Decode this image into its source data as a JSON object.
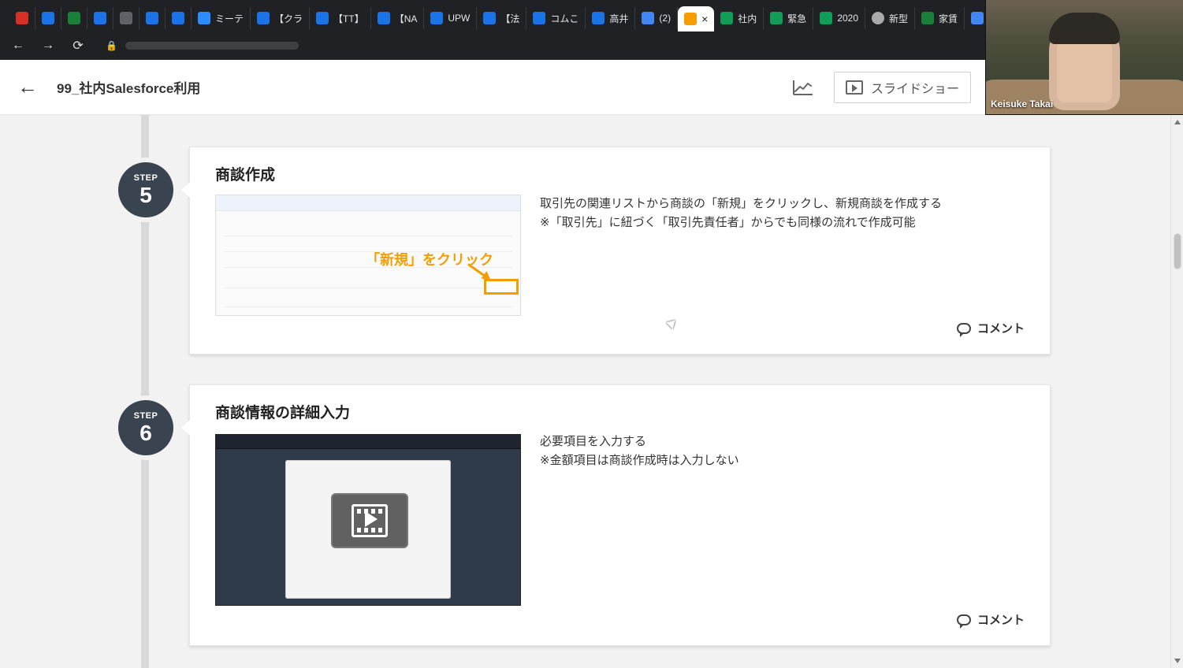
{
  "browser": {
    "tabs": [
      {
        "label": "",
        "icon": "gmail-icon",
        "active": false
      },
      {
        "label": "",
        "icon": "calendar-icon",
        "active": false
      },
      {
        "label": "",
        "icon": "drive-icon",
        "active": false
      },
      {
        "label": "",
        "icon": "blue-dot-icon",
        "active": false
      },
      {
        "label": "",
        "icon": "cloud-icon",
        "active": false
      },
      {
        "label": "",
        "icon": "chat-icon",
        "active": false
      },
      {
        "label": "",
        "icon": "salesforce-icon",
        "active": false
      },
      {
        "label": "ミーテ",
        "icon": "zoom-icon",
        "active": false
      },
      {
        "label": "【クラ",
        "icon": "salesforce-icon",
        "active": false
      },
      {
        "label": "【TT】",
        "icon": "salesforce-icon",
        "active": false
      },
      {
        "label": "【NA",
        "icon": "salesforce-icon",
        "active": false
      },
      {
        "label": "UPW",
        "icon": "salesforce-icon",
        "active": false
      },
      {
        "label": "【法",
        "icon": "salesforce-icon",
        "active": false
      },
      {
        "label": "コムこ",
        "icon": "salesforce-icon",
        "active": false
      },
      {
        "label": "高井",
        "icon": "salesforce-icon",
        "active": false
      },
      {
        "label": "(2)",
        "icon": "doc-icon",
        "active": false
      },
      {
        "label": "",
        "icon": "app-icon",
        "active": true,
        "close": "×"
      },
      {
        "label": "社内",
        "icon": "sheet-icon",
        "active": false
      },
      {
        "label": "緊急",
        "icon": "sheet-icon",
        "active": false
      },
      {
        "label": "2020",
        "icon": "sheet-icon",
        "active": false
      },
      {
        "label": "新型",
        "icon": "globe-icon",
        "active": false
      },
      {
        "label": "家賃",
        "icon": "drive-icon",
        "active": false
      },
      {
        "label": "",
        "icon": "document-icon",
        "active": false
      }
    ],
    "nav": {
      "back": "←",
      "forward": "→",
      "reload": "⟳",
      "lock": "🔒"
    }
  },
  "app": {
    "title": "99_社内Salesforce利用",
    "back_icon": "arrow-left-icon",
    "trend_icon": "trend-icon",
    "slideshow_label": "スライドショー"
  },
  "video_call": {
    "name": "Keisuke Takai"
  },
  "steps": [
    {
      "step_label": "STEP",
      "step_number": "5",
      "title": "商談作成",
      "image_overlay": "「新規」をクリック",
      "text_lines": [
        "取引先の関連リストから商談の「新規」をクリックし、新規商談を作成する",
        "※「取引先」に紐づく「取引先責任者」からでも同様の流れで作成可能"
      ],
      "comment_label": "コメント"
    },
    {
      "step_label": "STEP",
      "step_number": "6",
      "title": "商談情報の詳細入力",
      "text_lines": [
        "必要項目を入力する",
        "※金額項目は商談作成時は入力しない"
      ],
      "comment_label": "コメント"
    }
  ]
}
